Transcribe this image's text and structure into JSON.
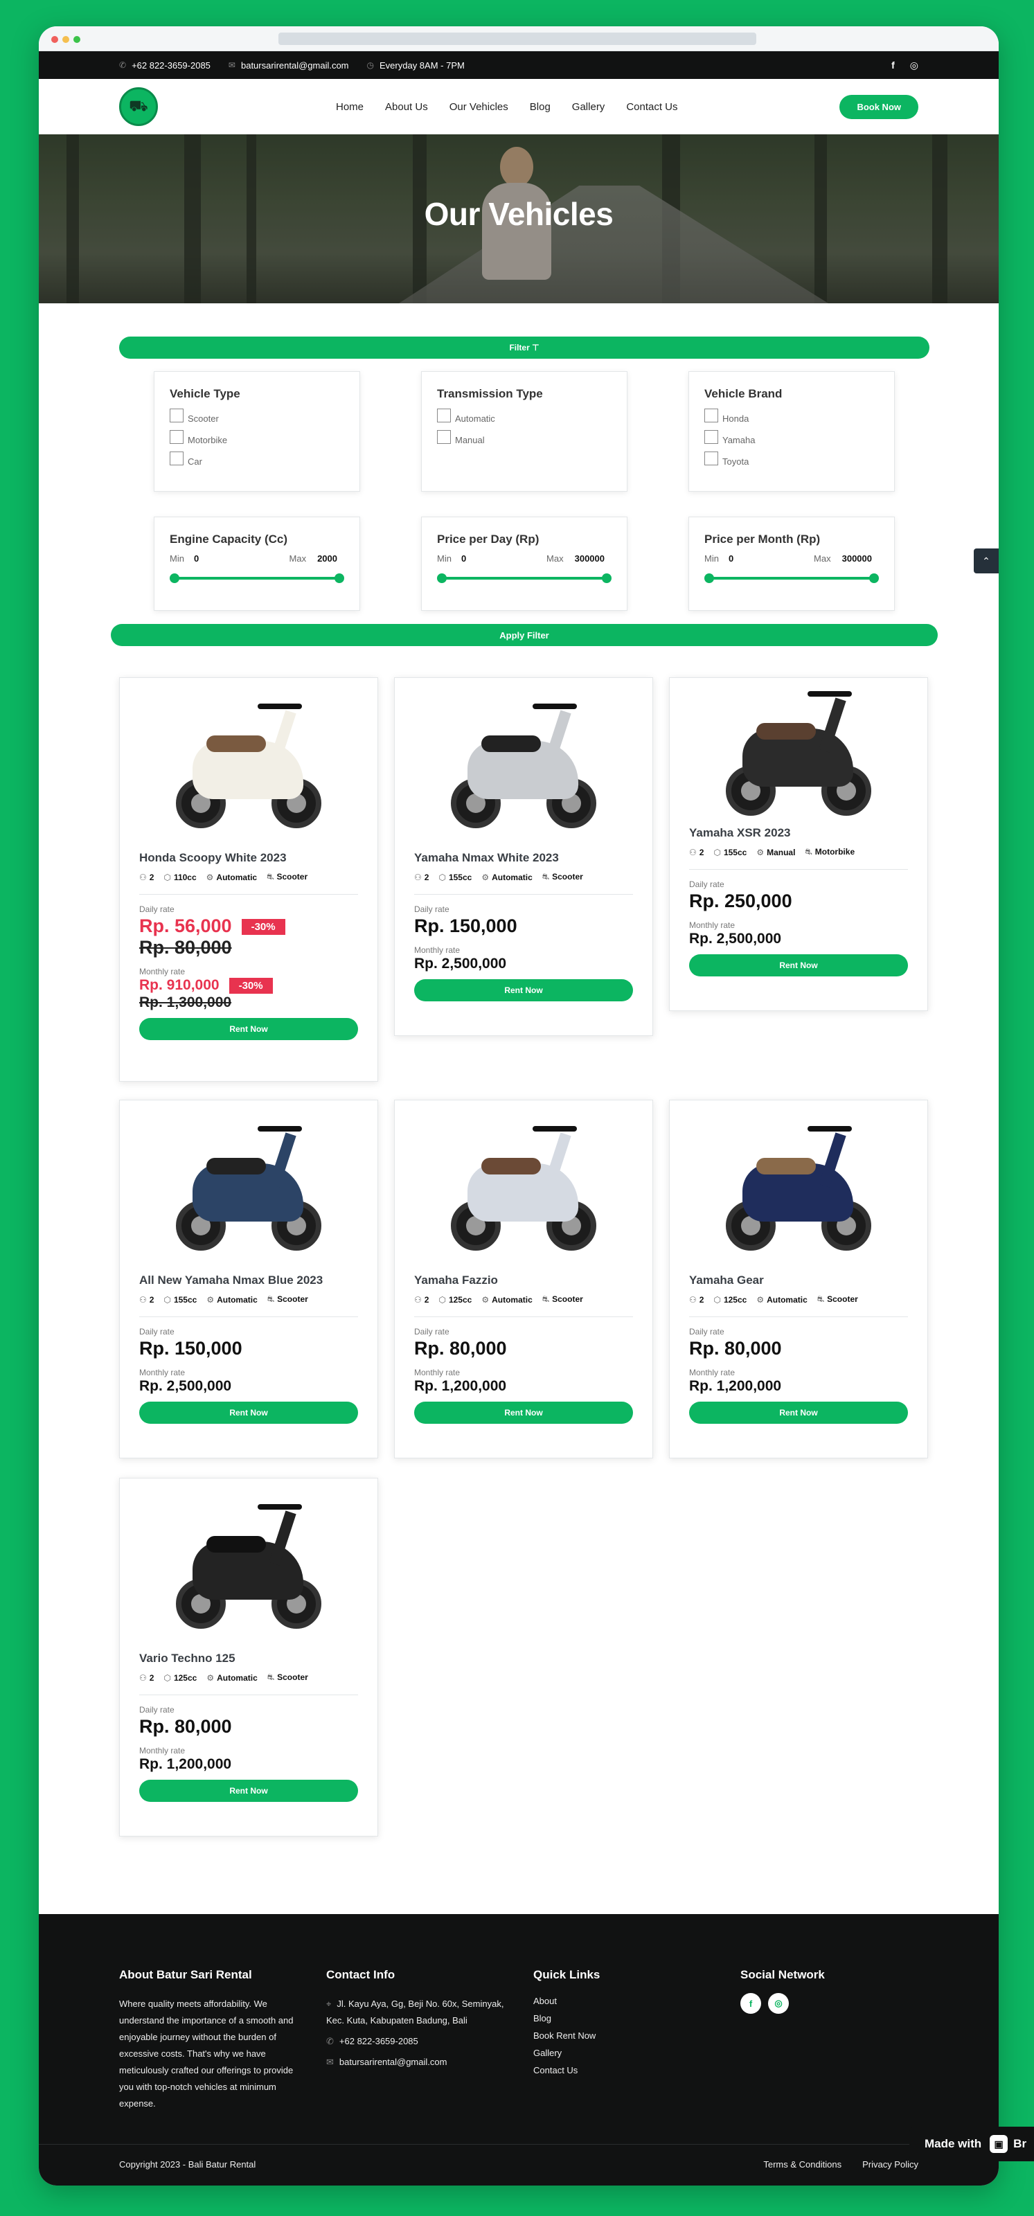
{
  "topbar": {
    "phone": "+62 822-3659-2085",
    "email": "batursarirental@gmail.com",
    "hours": "Everyday 8AM - 7PM"
  },
  "nav": {
    "items": [
      "Home",
      "About Us",
      "Our Vehicles",
      "Blog",
      "Gallery",
      "Contact Us"
    ],
    "book_label": "Book Now"
  },
  "hero": {
    "title": "Our Vehicles"
  },
  "filters": {
    "toggle_label": "Filter ⊤",
    "vehicle_type": {
      "title": "Vehicle Type",
      "options": [
        "Scooter",
        "Motorbike",
        "Car"
      ]
    },
    "transmission": {
      "title": "Transmission Type",
      "options": [
        "Automatic",
        "Manual"
      ]
    },
    "brand": {
      "title": "Vehicle Brand",
      "options": [
        "Honda",
        "Yamaha",
        "Toyota"
      ]
    },
    "engine": {
      "title": "Engine Capacity (Cc)",
      "min_label": "Min",
      "min": "0",
      "max_label": "Max",
      "max": "2000"
    },
    "price_day": {
      "title": "Price per Day (Rp)",
      "min_label": "Min",
      "min": "0",
      "max_label": "Max",
      "max": "300000"
    },
    "price_month": {
      "title": "Price per Month (Rp)",
      "min_label": "Min",
      "min": "0",
      "max_label": "Max",
      "max": "300000"
    },
    "apply_label": "Apply Filter"
  },
  "vehicles": [
    {
      "name": "Honda Scoopy White 2023",
      "seats": "2",
      "cc": "110cc",
      "trans": "Automatic",
      "kind": "Scooter",
      "daily_label": "Daily rate",
      "daily": "Rp. 56,000",
      "daily_old": "Rp. 80,000",
      "daily_badge": "-30%",
      "monthly_label": "Monthly rate",
      "monthly": "Rp. 910,000",
      "monthly_old": "Rp. 1,300,000",
      "monthly_badge": "-30%",
      "rent_label": "Rent Now",
      "color": "#f2efe6",
      "seat_color": "#7a5a40"
    },
    {
      "name": "Yamaha Nmax White 2023",
      "seats": "2",
      "cc": "155cc",
      "trans": "Automatic",
      "kind": "Scooter",
      "daily_label": "Daily rate",
      "daily": "Rp. 150,000",
      "monthly_label": "Monthly rate",
      "monthly": "Rp. 2,500,000",
      "rent_label": "Rent Now",
      "color": "#c9ccd0",
      "seat_color": "#222222"
    },
    {
      "name": "Yamaha XSR 2023",
      "seats": "2",
      "cc": "155cc",
      "trans": "Manual",
      "kind": "Motorbike",
      "daily_label": "Daily rate",
      "daily": "Rp. 250,000",
      "monthly_label": "Monthly rate",
      "monthly": "Rp. 2,500,000",
      "rent_label": "Rent Now",
      "color": "#2b2b2b",
      "seat_color": "#5a4030"
    },
    {
      "name": "All New Yamaha Nmax Blue 2023",
      "seats": "2",
      "cc": "155cc",
      "trans": "Automatic",
      "kind": "Scooter",
      "daily_label": "Daily rate",
      "daily": "Rp. 150,000",
      "monthly_label": "Monthly rate",
      "monthly": "Rp. 2,500,000",
      "rent_label": "Rent Now",
      "color": "#2c4466",
      "seat_color": "#222222"
    },
    {
      "name": "Yamaha Fazzio",
      "seats": "2",
      "cc": "125cc",
      "trans": "Automatic",
      "kind": "Scooter",
      "daily_label": "Daily rate",
      "daily": "Rp. 80,000",
      "monthly_label": "Monthly rate",
      "monthly": "Rp. 1,200,000",
      "rent_label": "Rent Now",
      "color": "#d5dae2",
      "seat_color": "#6b4a36"
    },
    {
      "name": "Yamaha Gear",
      "seats": "2",
      "cc": "125cc",
      "trans": "Automatic",
      "kind": "Scooter",
      "daily_label": "Daily rate",
      "daily": "Rp. 80,000",
      "monthly_label": "Monthly rate",
      "monthly": "Rp. 1,200,000",
      "rent_label": "Rent Now",
      "color": "#1f2d5c",
      "seat_color": "#8a6a4a"
    },
    {
      "name": "Vario Techno 125",
      "seats": "2",
      "cc": "125cc",
      "trans": "Automatic",
      "kind": "Scooter",
      "daily_label": "Daily rate",
      "daily": "Rp. 80,000",
      "monthly_label": "Monthly rate",
      "monthly": "Rp. 1,200,000",
      "rent_label": "Rent Now",
      "color": "#232323",
      "seat_color": "#111111"
    }
  ],
  "footer": {
    "about_title": "About Batur Sari Rental",
    "about_text": "Where quality meets affordability. We understand the importance of a smooth and enjoyable journey without the burden of excessive costs. That's why we have meticulously crafted our offerings to provide you with top-notch vehicles at minimum expense.",
    "contact_title": "Contact Info",
    "address": "Jl. Kayu Aya, Gg, Beji No. 60x, Seminyak, Kec. Kuta, Kabupaten Badung, Bali",
    "phone": "+62 822-3659-2085",
    "email": "batursarirental@gmail.com",
    "links_title": "Quick Links",
    "links": [
      "About",
      "Blog",
      "Book Rent Now",
      "Gallery",
      "Contact Us"
    ],
    "social_title": "Social Network",
    "copyright": "Copyright 2023 - Bali Batur Rental",
    "terms": "Terms & Conditions",
    "privacy": "Privacy Policy"
  },
  "made_with": {
    "label": "Made with",
    "brand": "Br"
  },
  "colors": {
    "accent": "#0cb561",
    "sale": "#e8334f",
    "dark": "#111212"
  }
}
